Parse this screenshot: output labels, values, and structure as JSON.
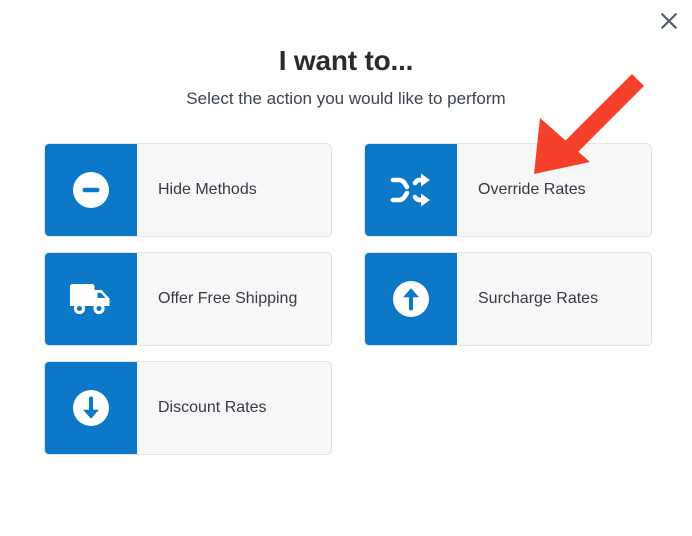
{
  "dialog": {
    "title": "I want to...",
    "subtitle": "Select the action you would like to perform",
    "close_label": "×",
    "close_icon": "close-icon"
  },
  "colors": {
    "icon_tile_blue": "#0b78c8",
    "card_body": "#f7f7f7",
    "card_border": "#e3e3e3",
    "title_text": "#2b2b2b",
    "subtitle_text": "#3b4450",
    "label_text": "#333a45",
    "annotation_red": "#f5402c",
    "close_icon": "#4e5b6b",
    "page_background": "#ffffff"
  },
  "actions": [
    {
      "label": "Hide Methods",
      "icon": "minus-circle-icon"
    },
    {
      "label": "Override Rates",
      "icon": "shuffle-icon"
    },
    {
      "label": "Offer Free Shipping",
      "icon": "delivery-truck-icon"
    },
    {
      "label": "Surcharge Rates",
      "icon": "arrow-up-circle-icon"
    },
    {
      "label": "Discount Rates",
      "icon": "arrow-down-circle-icon"
    }
  ],
  "annotation": {
    "icon": "red-pointer-arrow",
    "points_at": "Override Rates"
  }
}
